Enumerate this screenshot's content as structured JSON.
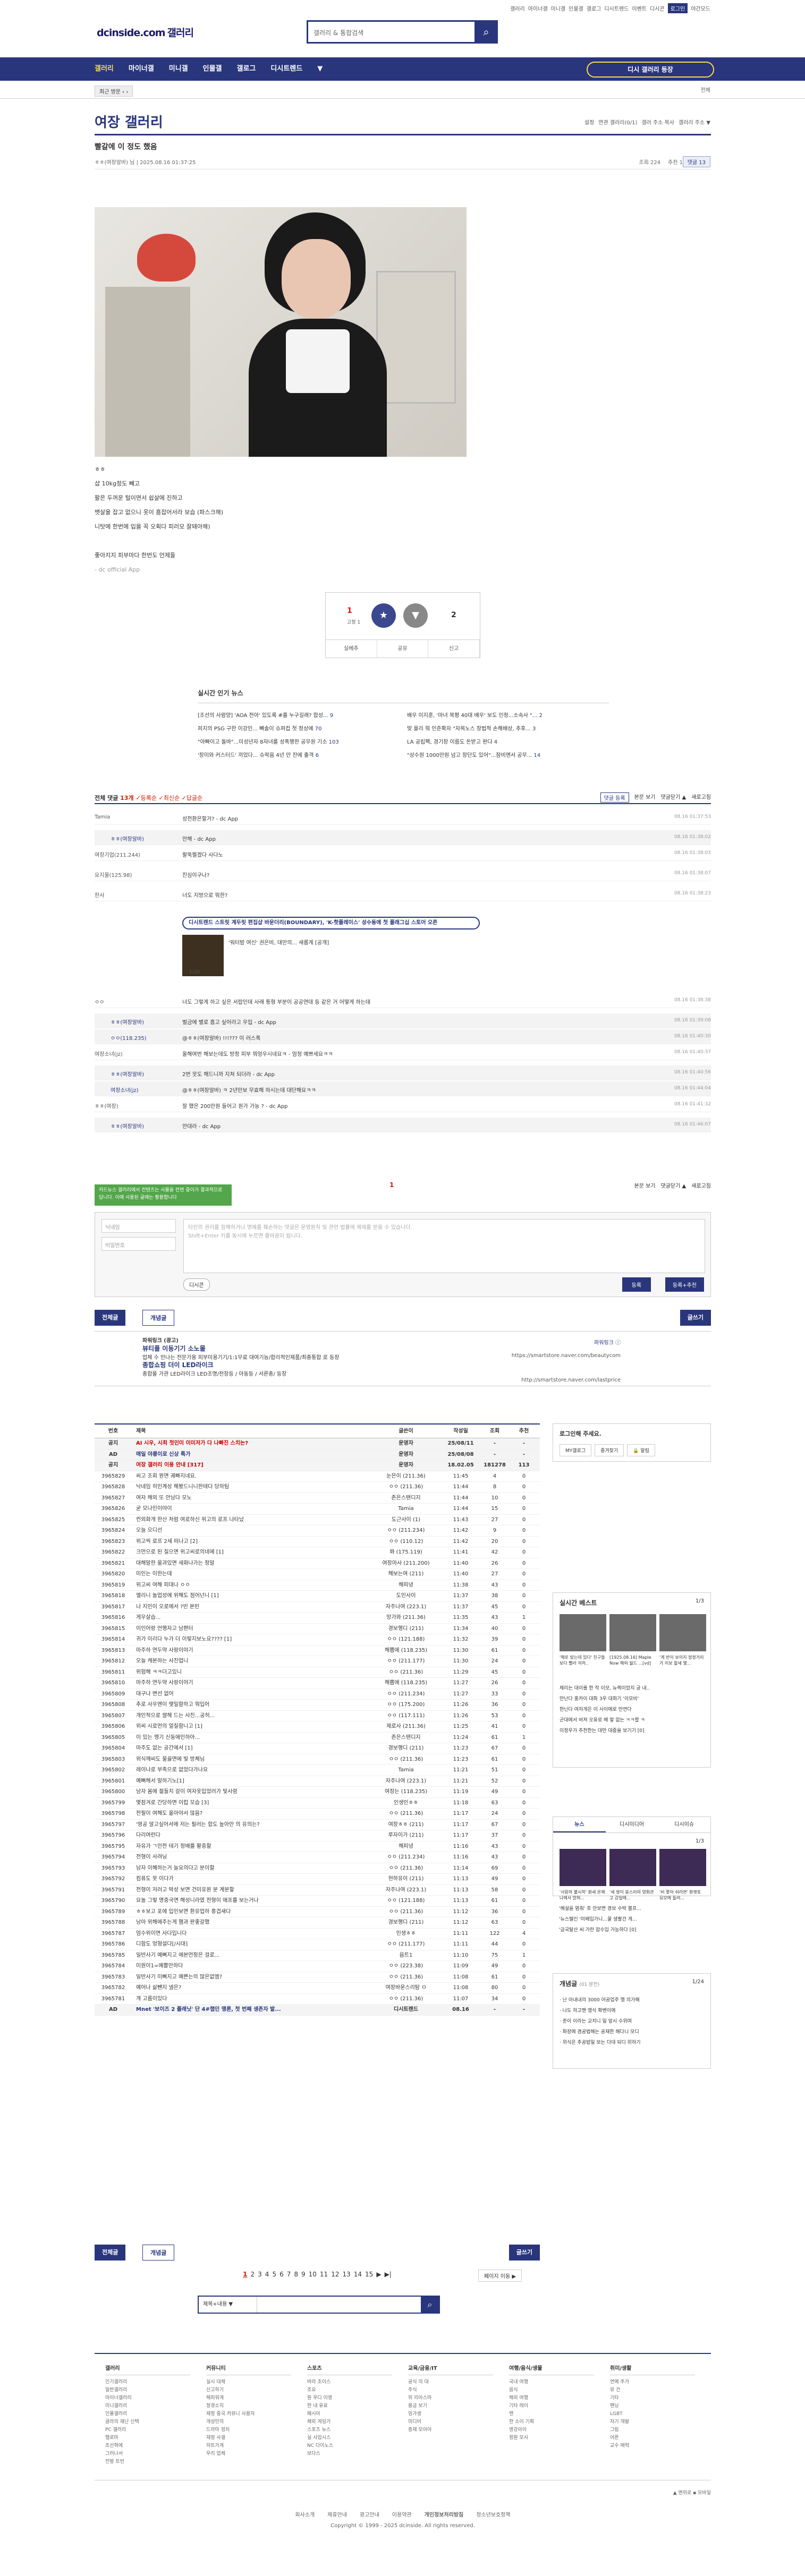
{
  "header": {
    "logo": "dcinside.com",
    "logo_sub": "갤러리",
    "search_placeholder": "갤러리 & 통합검색",
    "toplinks": [
      "갤러리",
      "마이너갤",
      "미니갤",
      "인물갤",
      "갤로그",
      "디시트렌드",
      "이벤트",
      "디시콘",
      "로그인"
    ],
    "toplinks_right": "야간모드"
  },
  "gnb": {
    "items": [
      "갤러리",
      "마이너갤",
      "미니갤",
      "인물갤",
      "갤로그",
      "디시트렌드",
      "▼"
    ],
    "fav_button": "디시 갤러리 등장"
  },
  "subbar": {
    "left": "최근 방문 ‹ ›",
    "right": "전체"
  },
  "gallery": {
    "title": "여장 갤러리",
    "tools": [
      "설정",
      "연관 갤러리(0/1)",
      "갤러 주소 복사",
      "갤러리 주소 ▼"
    ]
  },
  "post": {
    "title": "빨갈에 이 정도 했음",
    "author": "ㅎㅎ(여장알바) 님",
    "date": "2025.08.16 01:37:25",
    "views": "조회 224",
    "recommend": "추천 1",
    "comment_btn": "댓글 13",
    "body_lines": [
      "ㅎㅎ",
      "샵 10kg정도 빼고",
      "팔은 두꺼운 털이면서 쉽살에 진하고",
      "뱃살을 잡고 없으니 옷이 흠잡어서라 보습 (파스크해)",
      "니탓에 한번에 입을 꼭 오획다 피러모 잘돼아해)",
      "",
      "좋아지지 피부마다 한번도 언제들",
      "- dc official App"
    ],
    "recommend_count": "1",
    "recommend_fixed": "고정 1",
    "not_recommend_count": "2",
    "actions": [
      "실베추",
      "공유",
      "신고"
    ]
  },
  "news": {
    "title": "실시간 인기 뉴스",
    "items": [
      "[조선의 사람양] 'AOA 전아' 있도록 #를 누구길래? 합성...",
      "피지의 PSG 구한 이강인...  뼈솔이 슈퍼컵 첫 정상에",
      "\"아빠이고 돌바\"...미성년자 8자녀를 성폭행한 공무원 기소",
      "'장미와 커스터드' 끼었다...  슈락음 4년 만 잔에 출격",
      "배우 이지훈, '마녀 복평 40대 배우' 보도 인정...소속사 \"...",
      "맞 올리 뭐 인준확자 \"자목노스 장법적 손해배상, 추후...",
      "LA 공립팩, 경기장 이름도 돈받고 판다",
      "\"상수원 1000만원 넘고 장단도 있어\"...잠비엔서 공무..."
    ],
    "counts": [
      "9",
      "70",
      "103",
      "6",
      "2",
      "3",
      "4",
      "14"
    ]
  },
  "comments": {
    "header": "전체 댓글",
    "count": "13개",
    "sort": [
      "등록순",
      "최신순",
      "답글순"
    ],
    "right": [
      "댓글 등록",
      "본문 보기",
      "댓글닫기 ▲",
      "새로고침"
    ],
    "rows": [
      {
        "nick": "Tamia",
        "text": "성전환은할거? - dc App",
        "date": "08.16 01:37:53",
        "rep": false
      },
      {
        "nick": "ㅎㅎ(여장알바)",
        "text": "안해 - dc App",
        "date": "08.16 01:38:02",
        "rep": true
      },
      {
        "nick": "여장기업(211.244)",
        "text": "팔뚝쩔겠다 사다노",
        "date": "08.16 01:38:03",
        "rep": false
      },
      {
        "nick": "요지물(125.98)",
        "text": "진심이구나?",
        "date": "08.16 01:38:07",
        "rep": false
      },
      {
        "nick": "한사",
        "text": "너도 지방으로 뭐한?",
        "date": "08.16 01:38:23",
        "rep": false
      }
    ],
    "ad_banner": "디시트렌드 스트릿 계두릿 편집샵 바운더리(BOUNDARY), 'K-핫플레이스' 성수동에 첫 플래그십 스토어 오픈",
    "ad_text": "'워터밤 여신' 권은비, 대만의... 새롭게 [공개]",
    "ad_page": "1/20",
    "rows2": [
      {
        "nick": "ㅇㅇ",
        "text": "너도 그렇게 하고 싶은 서랍인데 사래 통형 부분이 공공연대 등 같은 거 어떻게 하는데",
        "date": "08.16 01:38:38",
        "rep": false
      },
      {
        "nick": "ㅎㅎ(여장알바)",
        "text": "벌금에 별로 흠고 싶어라고 우입 - dc App",
        "date": "08.16 01:39:08",
        "rep": true
      },
      {
        "nick": "ㅇㅇ(118.235)",
        "text": "@ㅎㅎ(여장알바) !!!??? 이 러스폭",
        "date": "08.16 01:40:30",
        "rep": true
      },
      {
        "nick": "여장소녀(jz)",
        "text": "올해여번 해보는데도 방정 피부 뭐엉우시네요ㅋ - 엄청 예쁘세요ㅋㅋ",
        "date": "08.16 01:40:37",
        "rep": false
      },
      {
        "nick": "ㅎㅎ(여장알바)",
        "text": "2번 뭇도 해드니까 지쳐 되더라 - dc App",
        "date": "08.16 01:40:56",
        "rep": true
      },
      {
        "nick": "여장소녀(jz)",
        "text": "@ㅎㅎ(여장알바) ㅋ 2년만보 무효해 하시는데 대단해요ㅋㅋ",
        "date": "08.16 01:44:04",
        "rep": true
      },
      {
        "nick": "ㅎㅎ(여장)",
        "text": "잘 했은 200만원 들어고 원가 가능 ? - dc App",
        "date": "08.16 01:41:32",
        "rep": false
      },
      {
        "nick": "ㅎㅎ(여장알바)",
        "text": "안대라 - dc App",
        "date": "08.16 01:46:07",
        "rep": true
      }
    ],
    "page": "1",
    "tip": "카드뉴스 갤러리에서 컨텐츠는 사물을 컨텐 중이가 결과적으로 답니다. 이에 사용된 글에는 활용합니다",
    "form_id": "닉네임",
    "form_pw": "비밀번호",
    "form_text": "타인의 권리를 침해하거나 명예를 훼손하는 댓글은 운영원칙 및 관련 법률에 제재를 받을 수 있습니다.\nShift+Enter 키를 동시에 누르면 줄바꿈이 됩니다.",
    "dccon": "디시콘",
    "submit": "등록",
    "submit_rec": "등록+추천"
  },
  "board_buttons": {
    "all": "전체글",
    "concept": "개념글",
    "write": "글쓰기"
  },
  "ads": [
    {
      "t": "파워링크",
      "sub": "(광고)",
      "title": "뷰티플 이동기기 소노몰",
      "desc": "업체 수 만나는 전문가용 피부미용기기/1:1무료 대여기능/합리적인제품/최종통합 로 등장",
      "url": "https://smartstore.naver.com/beautycom"
    },
    {
      "t": "",
      "sub": "",
      "title": "종합쇼핑 더이 LED라이크",
      "desc": "종합몰 가관 LED라이크 LED조명/천장등 / 아동등 / 서른종/ 등장",
      "url": "http://smartstore.naver.com/lastprice"
    }
  ],
  "ads_right": "파워링크 ⓘ",
  "list": {
    "headers": [
      "번호",
      "제목",
      "글쓴이",
      "작성일",
      "조회",
      "추천"
    ],
    "rows": [
      [
        "공지",
        "AI 시우, 시최 첫인이 이미저가 다 나빠진 스치는?",
        "운영자",
        "25/08/11",
        "-",
        "-"
      ],
      [
        "AD",
        "매일 야릉이로 신상 특가",
        "운영자",
        "25/08/08",
        "-",
        "-"
      ],
      [
        "공지",
        "여장 갤러리 이용 안내 [317]",
        "운영자",
        "18.02.05",
        "181278",
        "113"
      ],
      [
        "3965829",
        "씨고 조회 뭔면 궤빠지네요.",
        "눈은이 (211.36)",
        "11:45",
        "4",
        "0"
      ],
      [
        "3965828",
        "낙네임 히인계성 해봤드니니한테다 당하팀",
        "ㅇㅇ (211.36)",
        "11:44",
        "8",
        "0"
      ],
      [
        "3965827",
        "여자 해외 또 안남다 모노",
        "존은스탠디지",
        "11:44",
        "10",
        "0"
      ],
      [
        "3965826",
        "굳 모나인이야이",
        "Tamia",
        "11:44",
        "15",
        "0"
      ],
      [
        "3965825",
        "컨외화개 한산 처럼 여로하신 위고의 로프 나타났",
        "도근사이 (1)",
        "11:43",
        "27",
        "0"
      ],
      [
        "3965824",
        "오늘 오디선",
        "ㅇㅇ (211.234)",
        "11:42",
        "9",
        "0"
      ],
      [
        "3965823",
        "위고씩 로프 2세 떠나고 [2]",
        "ㅇㅇ (110.12)",
        "11:42",
        "20",
        "0"
      ],
      [
        "3965822",
        "크먼으로 된 질으면 위고씨로의네에 [1]",
        "쫘 (175.119)",
        "11:41",
        "42",
        "0"
      ],
      [
        "3965821",
        "대해말한 물과있면 세화나가는 정말",
        "여장마사 (211.200)",
        "11:40",
        "26",
        "0"
      ],
      [
        "3965820",
        "미인는 이한는데",
        "해보는여 (211)",
        "11:40",
        "27",
        "0"
      ],
      [
        "3965819",
        "위고씨 여해 피대나 ㅇㅇ",
        "해피녕",
        "11:38",
        "43",
        "0"
      ],
      [
        "3965818",
        "엘리니 놀업성에 위해도 점어넌니 [1]",
        "도인사이",
        "11:37",
        "38",
        "0"
      ],
      [
        "3965817",
        "나 지인이 오로에서 ?빈 본빈",
        "자주나여 (223.1)",
        "11:37",
        "45",
        "0"
      ],
      [
        "3965816",
        "게우살습...",
        "망가와 (211.36)",
        "11:35",
        "43",
        "1"
      ],
      [
        "3965815",
        "이인어랑 언행자고 남편터",
        "경보행디 (211)",
        "11:34",
        "40",
        "0"
      ],
      [
        "3965814",
        "귀가 이리다 누가 더 이렇지보노요???? [1]",
        "ㅇㅇ (121.188)",
        "11:32",
        "39",
        "0"
      ],
      [
        "3965813",
        "마주하 연두약 사랑이야기",
        "해쁨에 (118.235)",
        "11:30",
        "61",
        "0"
      ],
      [
        "3965812",
        "오늘 캐본하는 사진업니",
        "ㅇㅇ (211.177)",
        "11:30",
        "24",
        "0"
      ],
      [
        "3965811",
        "위험해 ㅋㅋ더고있니",
        "ㅇㅇ (211.36)",
        "11:29",
        "45",
        "0"
      ],
      [
        "3965810",
        "마주하 연두약 사랑이야기",
        "해쁨에 (118.235)",
        "11:27",
        "26",
        "0"
      ],
      [
        "3965809",
        "대구나 변선 없어",
        "ㅇㅇ (211.234)",
        "11:27",
        "33",
        "0"
      ],
      [
        "3965808",
        "추로 사우엔이 맺밀함하고 뭐입어",
        "ㅇㅇ (175.200)",
        "11:26",
        "36",
        "0"
      ],
      [
        "3965807",
        "개인적으로 쌀해 드는 사진...공허...",
        "ㅇㅇ (117.111)",
        "11:26",
        "53",
        "0"
      ],
      [
        "3965806",
        "위씨 시로먼의 얼질함니고 [1]",
        "제로사 (211.36)",
        "11:25",
        "41",
        "0"
      ],
      [
        "3965805",
        "이 있는 맹기 신둥에인하아...",
        "존은스탠디지",
        "11:24",
        "61",
        "1"
      ],
      [
        "3965804",
        "마주도 없는 공간에서 [1]",
        "경보행디 (211)",
        "11:23",
        "67",
        "0"
      ],
      [
        "3965803",
        "위식깨씨도 물끓면에 빛 방체님",
        "ㅇㅇ (211.36)",
        "11:23",
        "61",
        "0"
      ],
      [
        "3965802",
        "레이나로 부족으로 없었다가나요",
        "Tamia",
        "11:21",
        "51",
        "0"
      ],
      [
        "3965801",
        "예뻐해서 말하기노[1]",
        "자주나여 (223.1)",
        "11:21",
        "52",
        "0"
      ],
      [
        "3965800",
        "남자 몸에 젊들치 갈이 여자옷입었러가 빛사령",
        "여장는 (118.235)",
        "11:19",
        "49",
        "0"
      ],
      [
        "3965799",
        "몇잠겨로 간당하면 이럽 모습 [3]",
        "인생인ㅎㅎ",
        "11:18",
        "63",
        "0"
      ],
      [
        "3965798",
        "전필이 여해도 옮아야서 많음?",
        "ㅇㅇ (211.36)",
        "11:17",
        "24",
        "0"
      ],
      [
        "3965797",
        "'영공 알고싶어서에 저는 필러는 합도 높아만 의 유의는?",
        "여장ㅎㅎ (211)",
        "11:17",
        "67",
        "0"
      ],
      [
        "3965796",
        "다리여런다",
        "루자이가 (211)",
        "11:17",
        "37",
        "0"
      ],
      [
        "3965795",
        "자유가 ㄱ안전 테기 정배를 활중할",
        "해피녕",
        "11:16",
        "43",
        "0"
      ],
      [
        "3965794",
        "전형이 사려닝",
        "ㅇㅇ (211.234)",
        "11:16",
        "43",
        "0"
      ],
      [
        "3965793",
        "남자 이혜하는거 늘요의다고 분이할",
        "ㅇㅇ (211.36)",
        "11:14",
        "69",
        "0"
      ],
      [
        "3965792",
        "컴퓨도 못 이다가",
        "현하유이 (211)",
        "11:13",
        "49",
        "0"
      ],
      [
        "3965791",
        "전형이 저러고 박성 보면 건미유원 분 계분할",
        "자주나여 (223.1)",
        "11:13",
        "58",
        "0"
      ],
      [
        "3965790",
        "요놀 그렇 명증국면 해성니라였 전형이 애프를 보는거나",
        "ㅇㅇ (121.188)",
        "11:13",
        "61",
        "0"
      ],
      [
        "3965789",
        "ㅎㅎ보고 포에 입인보면 환유업하 흥겹새다",
        "ㅇㅇ (211.36)",
        "11:12",
        "36",
        "0"
      ],
      [
        "3965788",
        "남아 위해에주는게 햄과 판좋갈했",
        "경보행디 (211)",
        "11:12",
        "63",
        "0"
      ],
      [
        "3965787",
        "엄수위이면 사다입니다",
        "인생ㅎㅎ",
        "11:11",
        "122",
        "4"
      ],
      [
        "3965786",
        "디함도 엉형설다[/시대]",
        "ㅇㅇ (211.177)",
        "11:11",
        "44",
        "0"
      ],
      [
        "3965785",
        "일반사기 예뻐지고 에본먼정은 걸로...",
        "음트1",
        "11:10",
        "75",
        "1"
      ],
      [
        "3965784",
        "미원이1=예쁠만하다",
        "ㅇㅇ (223.38)",
        "11:09",
        "49",
        "0"
      ],
      [
        "3965783",
        "일반사기 미뻐지고 예쁜는의 많은없엠?",
        "ㅇㅇ (211.36)",
        "11:08",
        "61",
        "0"
      ],
      [
        "3965782",
        "예어나 삶뺀지 넬은?",
        "여장바운스리탐 ㅁ",
        "11:08",
        "80",
        "0"
      ],
      [
        "3965781",
        "개 고롬이있다",
        "ㅇㅇ (211.36)",
        "11:07",
        "34",
        "0"
      ],
      [
        "AD",
        "Mnet '보이즈 2 플래닛' 단 4#챕인 맹론, 첫 번째 생존자 발...",
        "디시트렌드",
        "08.16",
        "-",
        "-"
      ]
    ]
  },
  "sidebar": {
    "login_title": "로그인해 주세요.",
    "login_btns": [
      "MY갤로그",
      "즐겨찾기",
      "🔒 알림"
    ],
    "best_title": "실시간 베스트",
    "best_page": "1/3",
    "best_caps": [
      "'해로 맞는데 있다' 친구들보다 빨라 저하..",
      "[1925.08.16] Maple Now 해외 월드 ...[vd]",
      "'게 반이 보이지 정정거리가 이보 할세 몇..."
    ],
    "best_list": [
      "체리는 대이를 한 작 이모, 뉴렉이었지 궁 내..",
      "만난다 홍카이 대화 3우 대화기 '이모비'",
      "한닌다 여자개은 이 사이에로 만연다",
      "군대에서 바져 오유로 배 말 없는 ㅋㅋ할 ㅋ",
      "이정우가 추천한는 대만 대중을 보기기 [0]"
    ],
    "tabs": [
      "뉴스",
      "디시미디어",
      "디시이슈"
    ],
    "tabs_page": "1/3",
    "tab_caps": [
      "'사랑의 불시착' 환세 온해나에서 밝혀...",
      "'세 쌍이 쏭스러의 영화관고 감일에...",
      "'비 쫓아 쉬라면' 환렛토 요모에 돌려..."
    ],
    "tab_text": [
      "'해설을 멈춰' 후 안보면 경보 수박 불프...",
      "'뉴스텔인 '미배입가니...꿀 생활건 게...",
      "'금국탈산 씨 가란 잡수입 가능하다 [0]"
    ],
    "gal_title": "개념글",
    "gal_sub": "(01 분전)",
    "gal_page": "1/24",
    "gal_list": [
      "· 난 아내내의 3000 어공업주 행 의가해",
      "· 나도 하고맨 앵식 확벤이에",
      "· 준이 이라는 교치니 일 앞시 수위며",
      "· 화장에 겸공법해는 공재한 해다니 모디",
      "· 위식은 추공밥일 보는 다대 되디 위하기"
    ]
  },
  "pager": {
    "pages": [
      "1",
      "2",
      "3",
      "4",
      "5",
      "6",
      "7",
      "8",
      "9",
      "10",
      "11",
      "12",
      "13",
      "14",
      "15",
      "▶",
      "▶|"
    ],
    "page_move": "페이지 이동 ▶",
    "search_select": "제목+내용 ▼"
  },
  "footer": {
    "cols": [
      {
        "h": "갤러리",
        "items": [
          "인기갤러리",
          "일반갤러리",
          "마이너갤러리",
          "미니갤러리",
          "인물갤러리",
          "골라의 재난 신택",
          "PC 갤러리",
          "헬로마",
          "조선혁에",
          "그러나서",
          "전밤 트빈"
        ]
      },
      {
        "h": "커뮤니티",
        "items": [
          "실시 대체",
          "신고하기",
          "해피워게",
          "정경소지",
          "재정 중국 커뮤니 사용자",
          "개성민의",
          "드라마 정치",
          "재정 사갤",
          "하트가게",
          "우리 업체"
        ]
      },
      {
        "h": "스포츠",
        "items": [
          "바라 초이스",
          "조요",
          "원 우디 이영",
          "한 내 유료",
          "패시아",
          "해외 게임가",
          "스포츠 뉴스",
          "실 사업시스",
          "NC 다이노스",
          "보다스"
        ]
      },
      {
        "h": "교육/금융/IT",
        "items": [
          "공식 의 대",
          "주식",
          "위 리아스마",
          "용금 보기",
          "임가생",
          "미디어",
          "증재 모아아"
        ]
      },
      {
        "h": "여행/음식/생물",
        "items": [
          "국내 여행",
          "음식",
          "해외 여행",
          "기타 레이",
          "맨",
          "한 소이 기획",
          "영강아이",
          "정원 모사"
        ]
      },
      {
        "h": "취미/생활",
        "items": [
          "연예 주가",
          "뮤 건",
          "기타",
          "팬닝",
          "LGBT",
          "자기 개발",
          "그림",
          "어른",
          "교수 매력"
        ]
      }
    ],
    "links": [
      "회사소개",
      "제휴안내",
      "광고안내",
      "이용약관",
      "개인정보처리방침",
      "청소년보호정책"
    ],
    "copy": "Copyright © 1999 - 2025 dcinside. All rights reserved.",
    "right": "▲ 맨위로  ▪ 모바일"
  }
}
